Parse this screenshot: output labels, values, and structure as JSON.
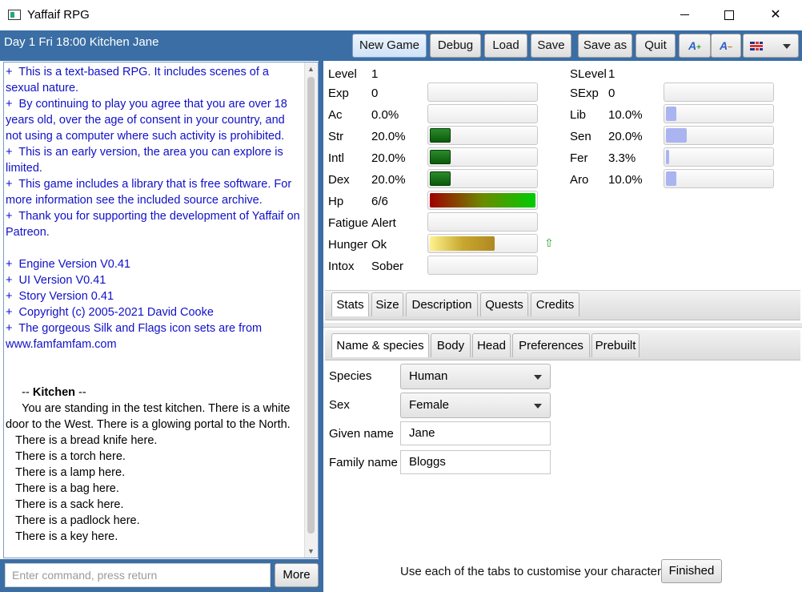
{
  "window": {
    "title": "Yaffaif RPG"
  },
  "status_text": "Day 1 Fri 18:00 Kitchen Jane",
  "toolbar": {
    "new_game": "New Game",
    "debug": "Debug",
    "load": "Load",
    "save": "Save",
    "save_as": "Save as",
    "quit": "Quit"
  },
  "log_lines": [
    {
      "text": "+  This is a text-based RPG. It includes scenes of a sexual nature.",
      "style": "blue"
    },
    {
      "text": "+  By continuing to play you agree that you are over 18 years old, over the age of consent in your country, and not using a computer where such activity is prohibited.",
      "style": "blue"
    },
    {
      "text": "+  This is an early version, the area you can explore is limited.",
      "style": "blue"
    },
    {
      "text": "+  This game includes a library that is free software. For more information see the included source archive.",
      "style": "blue"
    },
    {
      "text": "+  Thank you for supporting the development of Yaffaif on Patreon.",
      "style": "blue"
    },
    {
      "text": " ",
      "style": "plain"
    },
    {
      "text": "+  Engine Version V0.41",
      "style": "blue"
    },
    {
      "text": "+  UI Version V0.41",
      "style": "blue"
    },
    {
      "text": "+  Story Version 0.41",
      "style": "blue"
    },
    {
      "text": "+  Copyright (c) 2005-2021 David Cooke",
      "style": "blue"
    },
    {
      "text": "+  The gorgeous Silk and Flags icon sets are from www.famfamfam.com",
      "style": "blue"
    },
    {
      "text": " ",
      "style": "plain"
    },
    {
      "text": " ",
      "style": "plain"
    },
    {
      "text": "     -- ",
      "style": "plain",
      "bold_part": "Kitchen",
      "suffix": " --"
    },
    {
      "text": "     You are standing in the test kitchen. There is a white door to the West. There is a glowing portal to the North.",
      "style": "plain"
    },
    {
      "text": "   There is a bread knife here.",
      "style": "plain"
    },
    {
      "text": "   There is a torch here.",
      "style": "plain"
    },
    {
      "text": "   There is a lamp here.",
      "style": "plain"
    },
    {
      "text": "   There is a bag here.",
      "style": "plain"
    },
    {
      "text": "   There is a sack here.",
      "style": "plain"
    },
    {
      "text": "   There is a padlock here.",
      "style": "plain"
    },
    {
      "text": "   There is a key here.",
      "style": "plain"
    }
  ],
  "command": {
    "placeholder": "Enter command, press return",
    "more_label": "More"
  },
  "stats_left": {
    "level": {
      "label": "Level",
      "value": "1"
    },
    "exp": {
      "label": "Exp",
      "value": "0",
      "fill": 0
    },
    "ac": {
      "label": "Ac",
      "value": "0.0%",
      "fill": 0
    },
    "str": {
      "label": "Str",
      "value": "20.0%",
      "fill": 0.2
    },
    "intl": {
      "label": "Intl",
      "value": "20.0%",
      "fill": 0.2
    },
    "dex": {
      "label": "Dex",
      "value": "20.0%",
      "fill": 0.2
    },
    "hp": {
      "label": "Hp",
      "value": "6/6",
      "fill": 1.0
    },
    "fatigue": {
      "label": "Fatigue",
      "value": "Alert",
      "fill": 0
    },
    "hunger": {
      "label": "Hunger",
      "value": "Ok",
      "fill": 0.61
    },
    "intox": {
      "label": "Intox",
      "value": "Sober",
      "fill": 0
    }
  },
  "stats_right": {
    "slevel": {
      "label": "SLevel",
      "value": "1"
    },
    "sexp": {
      "label": "SExp",
      "value": "0",
      "fill": 0
    },
    "lib": {
      "label": "Lib",
      "value": "10.0%",
      "fill": 0.1
    },
    "sen": {
      "label": "Sen",
      "value": "20.0%",
      "fill": 0.2
    },
    "fer": {
      "label": "Fer",
      "value": "3.3%",
      "fill": 0.033
    },
    "aro": {
      "label": "Aro",
      "value": "10.0%",
      "fill": 0.1
    }
  },
  "tabs_main": [
    "Stats",
    "Size",
    "Description",
    "Quests",
    "Credits"
  ],
  "tabs_char": [
    "Name & species",
    "Body",
    "Head",
    "Preferences",
    "Prebuilt"
  ],
  "form": {
    "species_label": "Species",
    "species_value": "Human",
    "sex_label": "Sex",
    "sex_value": "Female",
    "given_label": "Given name",
    "given_value": "Jane",
    "family_label": "Family name",
    "family_value": "Bloggs"
  },
  "footer": {
    "hint": "Use each of the tabs to customise your character",
    "finished": "Finished"
  },
  "colors": {
    "accent": "#3a6ea5",
    "log_blue": "#1010c8",
    "stat_green": "#0a5a0a",
    "stat_blue": "#aab4f0"
  }
}
